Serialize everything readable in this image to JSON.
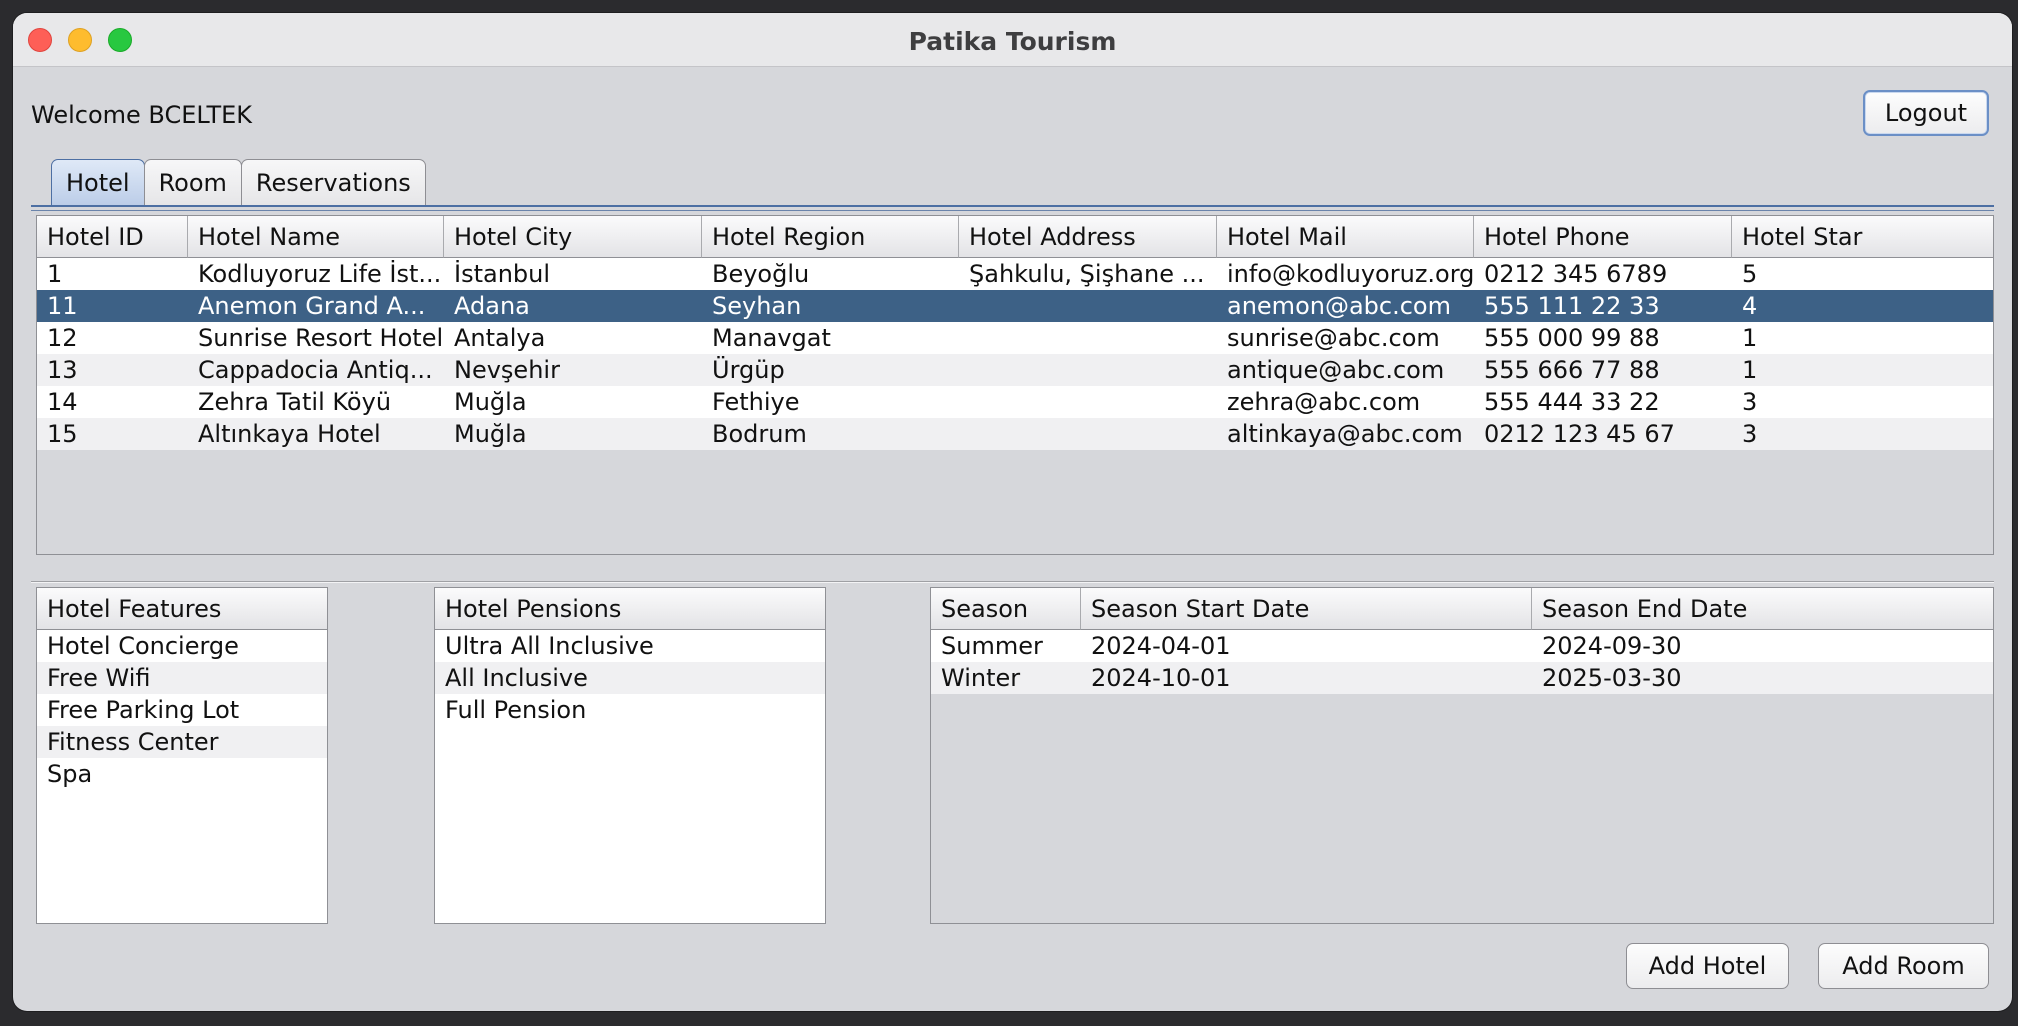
{
  "window": {
    "title": "Patika Tourism"
  },
  "header": {
    "welcome": "Welcome BCELTEK",
    "logout_label": "Logout"
  },
  "tabs": [
    {
      "label": "Hotel",
      "active": true
    },
    {
      "label": "Room",
      "active": false
    },
    {
      "label": "Reservations",
      "active": false
    }
  ],
  "hotel_table": {
    "columns": [
      "Hotel ID",
      "Hotel Name",
      "Hotel City",
      "Hotel Region",
      "Hotel Address",
      "Hotel Mail",
      "Hotel Phone",
      "Hotel Star"
    ],
    "rows": [
      [
        "1",
        "Kodluyoruz Life İst...",
        "İstanbul",
        "Beyoğlu",
        "Şahkulu, Şişhane ...",
        "info@kodluyoruz.org",
        "0212 345 6789",
        "5"
      ],
      [
        "11",
        "Anemon Grand A...",
        "Adana",
        "Seyhan",
        "",
        "anemon@abc.com",
        "555 111 22 33",
        "4"
      ],
      [
        "12",
        "Sunrise Resort Hotel",
        "Antalya",
        "Manavgat",
        "",
        "sunrise@abc.com",
        "555 000 99 88",
        "1"
      ],
      [
        "13",
        "Cappadocia Antiq...",
        "Nevşehir",
        "Ürgüp",
        "",
        "antique@abc.com",
        "555 666 77 88",
        "1"
      ],
      [
        "14",
        "Zehra Tatil Köyü",
        "Muğla",
        "Fethiye",
        "",
        "zehra@abc.com",
        "555 444 33 22",
        "3"
      ],
      [
        "15",
        "Altınkaya Hotel",
        "Muğla",
        "Bodrum",
        "",
        "altinkaya@abc.com",
        "0212 123 45 67",
        "3"
      ]
    ],
    "selected_row": 1
  },
  "features": {
    "header": "Hotel Features",
    "items": [
      "Hotel Concierge",
      "Free Wifi",
      "Free Parking Lot",
      "Fitness Center",
      "Spa"
    ]
  },
  "pensions": {
    "header": "Hotel Pensions",
    "items": [
      "Ultra All Inclusive",
      "All Inclusive",
      "Full Pension"
    ]
  },
  "seasons": {
    "columns": [
      "Season",
      "Season Start Date",
      "Season End Date"
    ],
    "rows": [
      [
        "Summer",
        "2024-04-01",
        "2024-09-30"
      ],
      [
        "Winter",
        "2024-10-01",
        "2025-03-30"
      ]
    ]
  },
  "actions": {
    "add_hotel": "Add Hotel",
    "add_room": "Add Room"
  }
}
